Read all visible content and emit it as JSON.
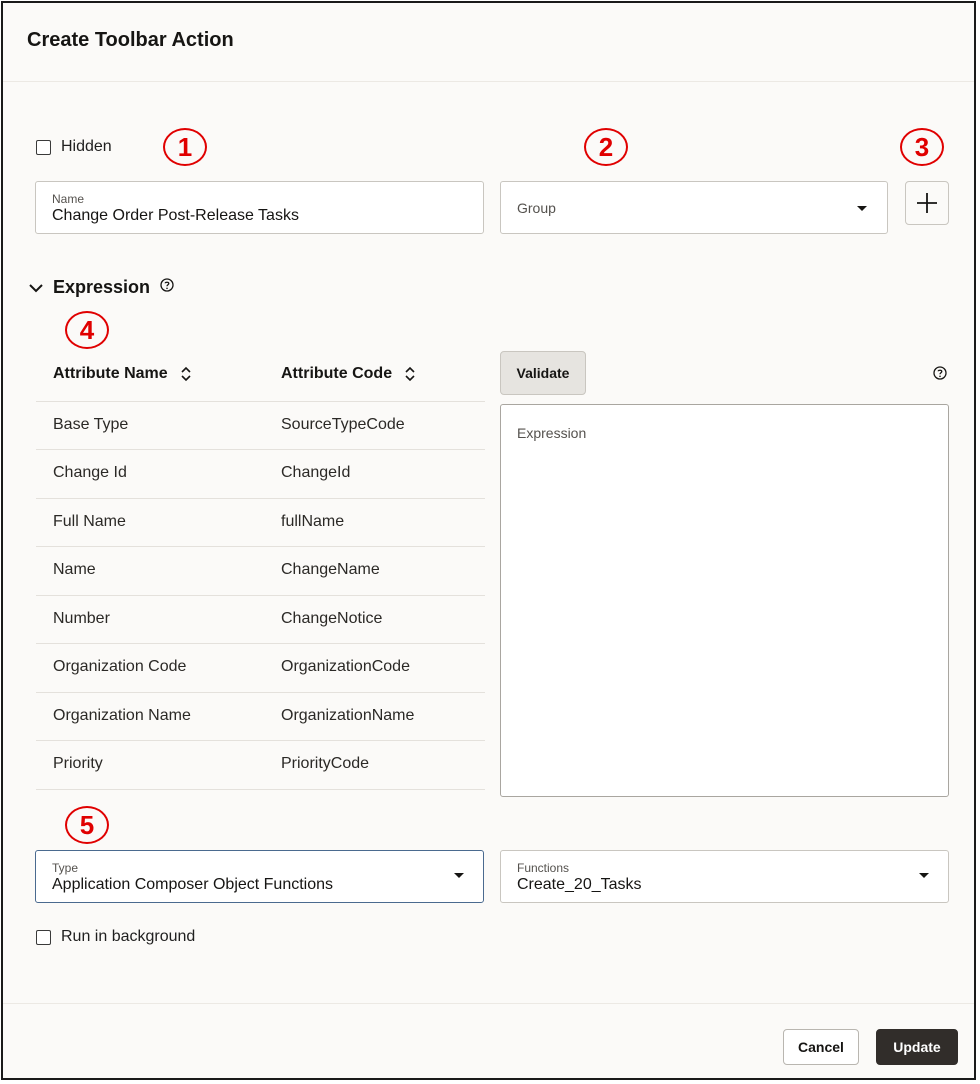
{
  "dialog": {
    "title": "Create Toolbar Action"
  },
  "hidden_checkbox": {
    "label": "Hidden",
    "checked": false
  },
  "name_field": {
    "label": "Name",
    "value": "Change Order Post-Release Tasks"
  },
  "group_field": {
    "placeholder": "Group"
  },
  "add_group_button": {
    "icon": "plus-icon"
  },
  "expression_section": {
    "title": "Expression",
    "expanded": true
  },
  "attributes_table": {
    "headers": [
      "Attribute Name",
      "Attribute Code"
    ],
    "rows": [
      [
        "Base Type",
        "SourceTypeCode"
      ],
      [
        "Change Id",
        "ChangeId"
      ],
      [
        "Full Name",
        "fullName"
      ],
      [
        "Name",
        "ChangeName"
      ],
      [
        "Number",
        "ChangeNotice"
      ],
      [
        "Organization Code",
        "OrganizationCode"
      ],
      [
        "Organization Name",
        "OrganizationName"
      ],
      [
        "Priority",
        "PriorityCode"
      ]
    ]
  },
  "validate_button": {
    "label": "Validate"
  },
  "expression_field": {
    "placeholder": "Expression"
  },
  "type_field": {
    "label": "Type",
    "value": "Application Composer Object Functions"
  },
  "functions_field": {
    "label": "Functions",
    "value": "Create_20_Tasks"
  },
  "background_checkbox": {
    "label": "Run in background",
    "checked": false
  },
  "footer": {
    "cancel_label": "Cancel",
    "update_label": "Update"
  },
  "callouts": [
    "1",
    "2",
    "3",
    "4",
    "5"
  ],
  "colors": {
    "callout": "#e00000",
    "primary_button": "#312d2a",
    "focus_border": "#4a6a8f"
  }
}
